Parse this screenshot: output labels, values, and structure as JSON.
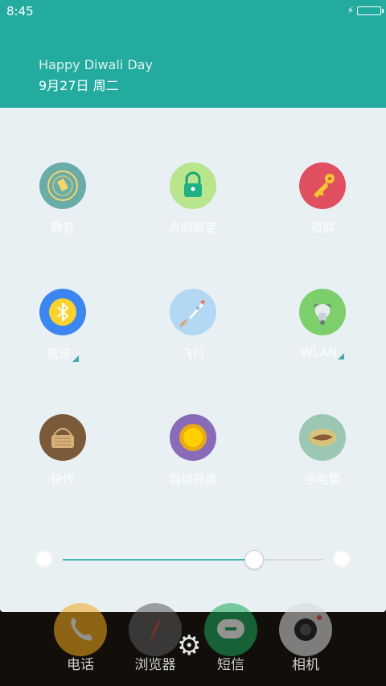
{
  "status": {
    "time": "8:45"
  },
  "header": {
    "greeting": "Happy Diwali Day",
    "date": "9月27日 周二"
  },
  "tiles": [
    {
      "label": "静音",
      "icon": "bell-icon",
      "bg": "#6aaca8"
    },
    {
      "label": "方向锁定",
      "icon": "lock-icon",
      "bg": "#b9e58d"
    },
    {
      "label": "锁屏",
      "icon": "key-icon",
      "bg": "#e05060"
    },
    {
      "label": "蓝牙",
      "icon": "bluetooth-icon",
      "bg": "#3b86f0"
    },
    {
      "label": "飞行",
      "icon": "rocket-icon",
      "bg": "#b2d8f3"
    },
    {
      "label": "WLAN",
      "icon": "scooter-icon",
      "bg": "#7dcf6c"
    },
    {
      "label": "快传",
      "icon": "basket-icon",
      "bg": "#7b5a3a"
    },
    {
      "label": "自动亮度",
      "icon": "sun-icon",
      "bg": "#8a6bb8"
    },
    {
      "label": "手电筒",
      "icon": "flashlight-icon",
      "bg": "#9bc7b3"
    }
  ],
  "brightness": {
    "level": 0.73
  },
  "dock": [
    {
      "label": "电话",
      "icon": "phone-icon"
    },
    {
      "label": "浏览器",
      "icon": "compass-icon"
    },
    {
      "label": "短信",
      "icon": "message-icon"
    },
    {
      "label": "相机",
      "icon": "camera-icon"
    }
  ]
}
